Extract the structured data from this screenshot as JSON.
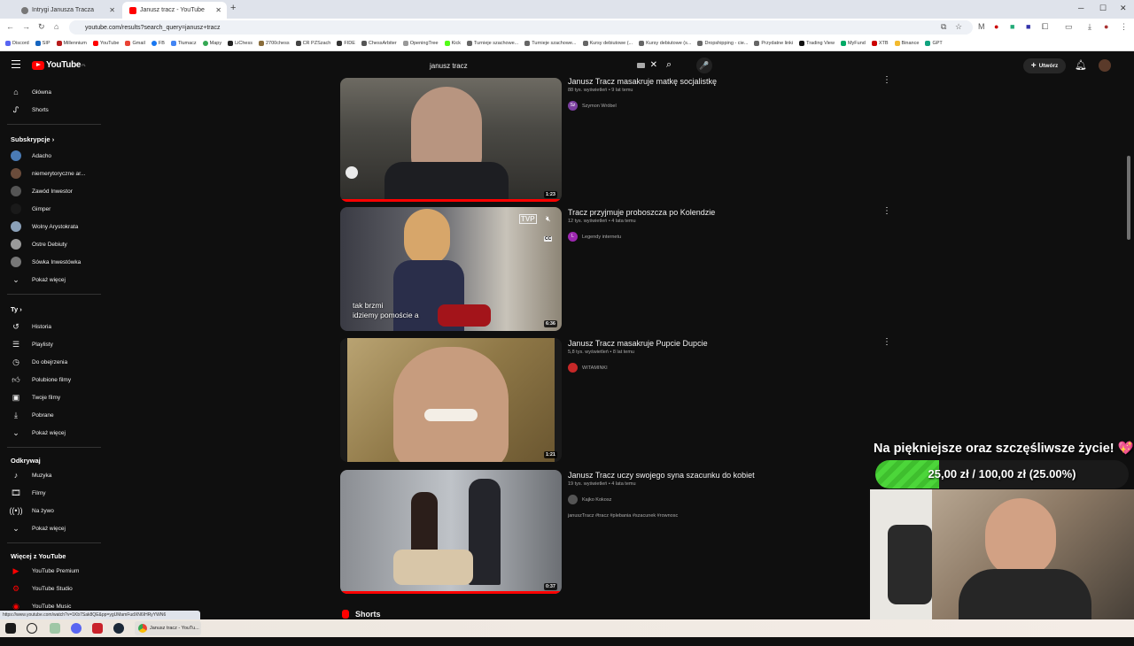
{
  "browser": {
    "tabs": [
      {
        "title": "Intrygi Janusza Tracza",
        "active": false
      },
      {
        "title": "Janusz tracz - YouTube",
        "active": true
      }
    ],
    "url": "youtube.com/results?search_query=janusz+tracz",
    "bookmarks": [
      "Discord",
      "SIP",
      "Millennium",
      "YouTube",
      "Gmail",
      "FB",
      "Tłumacz",
      "Mapy",
      "LiChess",
      "2700chess",
      "CR PZSzach",
      "FIDE",
      "ChessArbiter",
      "OpeningTree",
      "Kick",
      "Turnieje szachowe...",
      "Turnieje szachowe...",
      "Kursy debiutowe (...",
      "Kursy debiutowe (s...",
      "Dropshipping - cie...",
      "Przydatne linki",
      "Trading View",
      "MyFund",
      "XTB",
      "Binance",
      "GPT"
    ],
    "status_url": "https://www.youtube.com/watch?v=1Kb7Sak8QE&pp=ygUMamFudXN6IHRyYWN6"
  },
  "youtube": {
    "logo": "YouTube",
    "region": "PL",
    "search_value": "janusz tracz",
    "create_label": "Utwórz",
    "sidebar": {
      "top": [
        {
          "label": "Główna",
          "icon": "home-icon"
        },
        {
          "label": "Shorts",
          "icon": "shorts-icon"
        }
      ],
      "subs_heading": "Subskrypcje",
      "subs": [
        {
          "label": "Adacho",
          "color": "#4a7bb5"
        },
        {
          "label": "niemerytoryczne ar...",
          "color": "#6b4c3b"
        },
        {
          "label": "Zawód Inwestor",
          "color": "#555555"
        },
        {
          "label": "Gimper",
          "color": "#1a1a1a"
        },
        {
          "label": "Wolny Arystokrata",
          "color": "#8aa0b8"
        },
        {
          "label": "Ostre Debiuty",
          "color": "#9a9a9a"
        },
        {
          "label": "Sówka Inwestówka",
          "color": "#777777"
        }
      ],
      "subs_more": "Pokaż więcej",
      "you_heading": "Ty",
      "you": [
        {
          "label": "Historia",
          "icon": "history-icon"
        },
        {
          "label": "Playlisty",
          "icon": "playlist-icon"
        },
        {
          "label": "Do obejrzenia",
          "icon": "watch-later-icon"
        },
        {
          "label": "Polubione filmy",
          "icon": "like-icon"
        },
        {
          "label": "Twoje filmy",
          "icon": "your-videos-icon"
        },
        {
          "label": "Pobrane",
          "icon": "download-icon"
        }
      ],
      "you_more": "Pokaż więcej",
      "explore_heading": "Odkrywaj",
      "explore": [
        {
          "label": "Muzyka",
          "icon": "music-icon"
        },
        {
          "label": "Filmy",
          "icon": "film-icon"
        },
        {
          "label": "Na żywo",
          "icon": "live-icon"
        }
      ],
      "explore_more": "Pokaż więcej",
      "more_heading": "Więcej z YouTube",
      "more": [
        {
          "label": "YouTube Premium"
        },
        {
          "label": "YouTube Studio"
        },
        {
          "label": "YouTube Music"
        }
      ]
    },
    "results": [
      {
        "title": "Janusz Tracz masakruje matkę socjalistkę",
        "meta": "88 tys. wyświetleń • 9 lat temu",
        "channel": "Szymon Wróbel",
        "channel_initial": "Sz",
        "channel_color": "#7b3fa0",
        "duration": "1:23",
        "progress": 1.0
      },
      {
        "title": "Tracz przyjmuje proboszcza po Kolendzie",
        "meta": "12 tys. wyświetleń • 4 lata temu",
        "channel": "Legendy internetu",
        "channel_initial": "L",
        "channel_color": "#9c27b0",
        "duration": "6:36",
        "progress": 0,
        "caption_line1": "tak brzmi",
        "caption_line2": "idziemy pomoście a",
        "broadcaster": "TVP",
        "cc": "CC"
      },
      {
        "title": "Janusz Tracz masakruje Pupcie Dupcie",
        "meta": "5,8 tys. wyświetleń • 8 lat temu",
        "channel": "WITAMINKI",
        "channel_initial": "",
        "channel_color": "#c62828",
        "duration": "1:21",
        "progress": 0
      },
      {
        "title": "Janusz Tracz uczy swojego syna szacunku do kobiet",
        "meta": "19 tys. wyświetleń • 4 lata temu",
        "channel": "Kajko Kokosz",
        "channel_initial": "",
        "channel_color": "#555555",
        "duration": "0:37",
        "progress": 1.0,
        "tags": "januszTracz #tracz #plebania #szacunek #rownosc"
      }
    ],
    "shorts_label": "Shorts"
  },
  "overlay": {
    "title": "Na piękniejsze oraz szczęśliwsze życie!",
    "heart": "💖",
    "progress_text": "25,00 zł / 100,00 zł (25.00%)",
    "progress_fraction": 0.25
  },
  "taskbar": {
    "active_app": "Janusz tracz - YouTu..."
  }
}
